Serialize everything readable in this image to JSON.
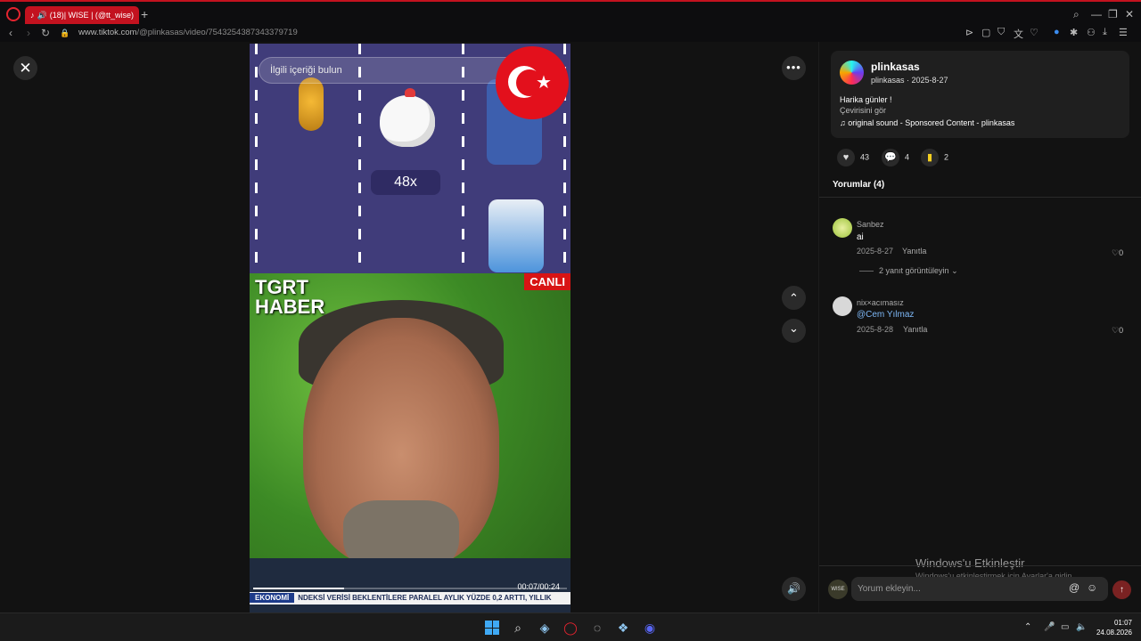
{
  "browser": {
    "tab_title": "(18)| WISE | (@tt_wise)",
    "new_tab": "+",
    "url_host": "www.tiktok.com",
    "url_path": "/@plinkasas/video/7543254387343379719",
    "back_icon": "‹",
    "forward_icon": "›",
    "reload_icon": "↻",
    "lock_icon": "🔒"
  },
  "viewer": {
    "close_label": "✕",
    "more_label": "•••",
    "up_label": "⌃",
    "down_label": "⌄",
    "volume_label": "🔊"
  },
  "video": {
    "search_placeholder": "İlgili içeriği bulun",
    "multiplier": "48x",
    "channel_name": "TGRT\nHABER",
    "live_badge": "CANLI",
    "timecode": "00:07/00:24",
    "progress": 0.29,
    "ticker_tag": "EKONOMİ",
    "ticker_text": "NDEKSİ VERİSİ BEKLENTİLERE PARALEL AYLIK YÜZDE 0,2 ARTTI, YILLIK"
  },
  "post": {
    "author": "plinkasas",
    "meta": "plinkasas · 2025-8-27",
    "caption": "Harika günler !",
    "translate": "Çevirisini gör",
    "sound": "♫ original sound - Sponsored Content - plinkasas",
    "likes": "43",
    "comments": "4",
    "saves": "2"
  },
  "comments": {
    "title": "Yorumlar (4)",
    "items": [
      {
        "user": "Sanbez",
        "text": "ai",
        "date": "2025-8-27",
        "reply": "Yanıtla",
        "likes": "0"
      },
      {
        "user": "nix×acımasız",
        "text": "@Cem Yılmaz",
        "date": "2025-8-28",
        "reply": "Yanıtla",
        "likes": "0"
      }
    ],
    "view_replies": "2 yanıt görüntüleyin",
    "input_placeholder": "Yorum ekleyin...",
    "input_avatar": "WISE"
  },
  "watermark": {
    "line1": "Windows'u Etkinleştir",
    "line2": "Windows'u etkinleştirmek için Ayarlar'a gidin."
  },
  "taskbar": {
    "time": "01:07",
    "date": "24.08.2026"
  },
  "colors": {
    "accent": "#c3121f",
    "send": "#7a2222",
    "mention": "#7db7f5"
  }
}
